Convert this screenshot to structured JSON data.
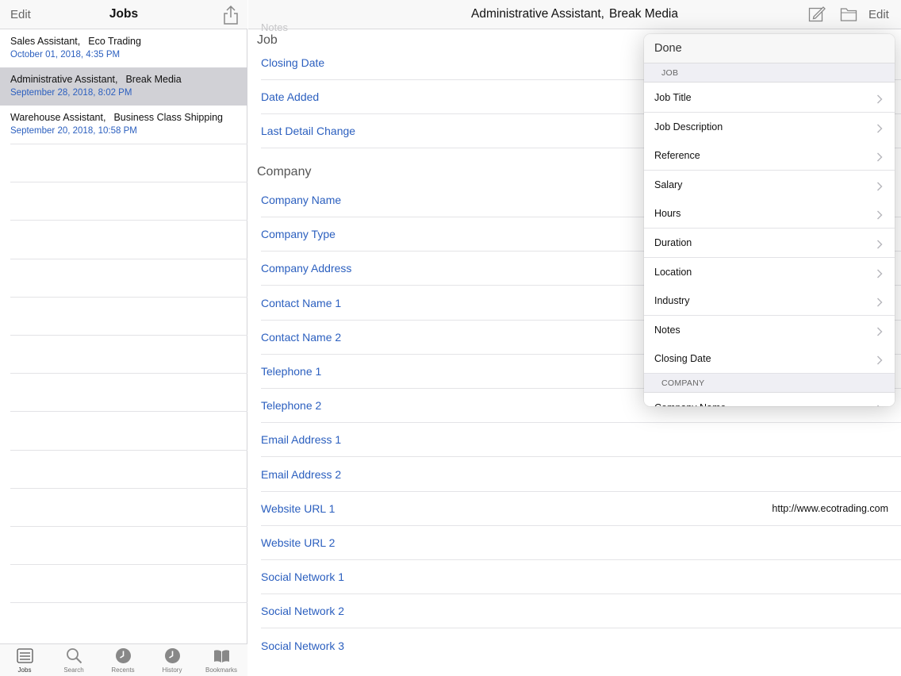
{
  "left": {
    "edit_label": "Edit",
    "title": "Jobs",
    "share_icon": "share-icon",
    "jobs": [
      {
        "title": "Sales Assistant,",
        "company": "Eco Trading",
        "date": "October 01, 2018, 4:35 PM",
        "selected": false
      },
      {
        "title": "Administrative Assistant,",
        "company": "Break Media",
        "date": "September 28, 2018, 8:02 PM",
        "selected": true
      },
      {
        "title": "Warehouse Assistant,",
        "company": "Business Class Shipping",
        "date": "September 20, 2018, 10:58 PM",
        "selected": false
      }
    ],
    "tabs": [
      {
        "label": "Jobs",
        "icon": "list-icon",
        "active": true
      },
      {
        "label": "Search",
        "icon": "search-icon",
        "active": false
      },
      {
        "label": "Recents",
        "icon": "clock-icon",
        "active": false
      },
      {
        "label": "History",
        "icon": "clock-icon",
        "active": false
      },
      {
        "label": "Bookmarks",
        "icon": "book-icon",
        "active": false
      }
    ]
  },
  "right": {
    "title_job": "Administrative Assistant,",
    "title_company": "Break Media",
    "compose_icon": "compose-icon",
    "folder_icon": "folder-icon",
    "edit_label": "Edit",
    "ghost_label": "Notes",
    "job_section": "Job",
    "job_fields": [
      {
        "label": "Closing Date",
        "value": ""
      },
      {
        "label": "Date Added",
        "value": ""
      },
      {
        "label": "Last Detail Change",
        "value": ""
      }
    ],
    "company_section": "Company",
    "company_fields": [
      {
        "label": "Company Name",
        "value": ""
      },
      {
        "label": "Company Type",
        "value": ""
      },
      {
        "label": "Company Address",
        "value": ""
      },
      {
        "label": "Contact Name 1",
        "value": ""
      },
      {
        "label": "Contact Name 2",
        "value": ""
      },
      {
        "label": "Telephone 1",
        "value": ""
      },
      {
        "label": "Telephone 2",
        "value": ""
      },
      {
        "label": "Email Address 1",
        "value": ""
      },
      {
        "label": "Email Address 2",
        "value": ""
      },
      {
        "label": "Website URL 1",
        "value": "http://www.ecotrading.com"
      },
      {
        "label": "Website URL 2",
        "value": ""
      },
      {
        "label": "Social Network 1",
        "value": ""
      },
      {
        "label": "Social Network 2",
        "value": ""
      },
      {
        "label": "Social Network 3",
        "value": ""
      }
    ]
  },
  "popover": {
    "done_label": "Done",
    "job_section": "JOB",
    "job_items": [
      "Job Title",
      "Job Description",
      "Reference",
      "Salary",
      "Hours",
      "Duration",
      "Location",
      "Industry",
      "Notes",
      "Closing Date"
    ],
    "company_section": "COMPANY",
    "company_items": [
      "Company Name"
    ]
  },
  "colors": {
    "accent_blue": "#2b5fbf",
    "selected_row": "#d1d1d6"
  }
}
